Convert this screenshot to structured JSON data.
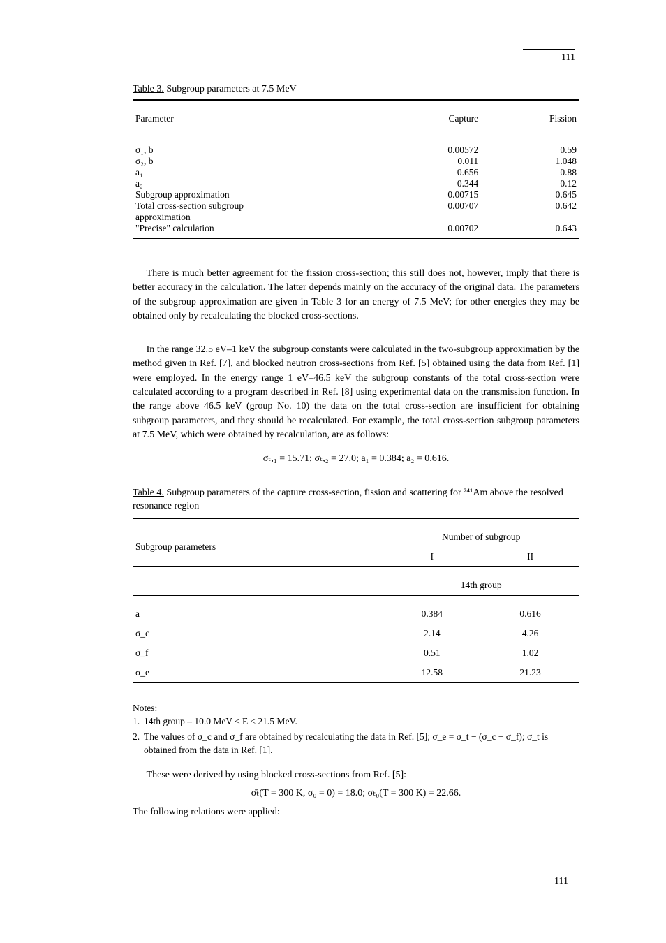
{
  "header": {
    "page_number": "111"
  },
  "table1": {
    "title_prefix": "Table 3.",
    "title_rest": " Subgroup parameters at 7.5 MeV",
    "headers": {
      "c1": "Parameter",
      "c2": "Capture",
      "c3": "Fission"
    },
    "row": {
      "c1": "σ₁, b\nσ₂, b\na₁\na₂\nSubgroup approximation\nTotal cross-section subgroup\napproximation\n\"Precise\" calculation",
      "c2": "0.00572\n0.011\n0.656\n0.344\n0.00715\n0.00707\n\n0.00702",
      "c3": "0.59\n1.048\n0.88\n0.12\n0.645\n0.642\n\n0.643"
    }
  },
  "para1": "There is much better agreement for the fission cross-section; this still does not, however, imply that there is better accuracy in the calculation. The latter depends mainly on the accuracy of the original data. The parameters of the subgroup approximation are given in Table 3 for an energy of 7.5 MeV; for other energies they may be obtained only by recalculating the blocked cross-sections.",
  "para2": "In the range 32.5 eV–1 keV the subgroup constants were calculated in the two-subgroup approximation by the method given in Ref. [7], and blocked neutron cross-sections from Ref. [5] obtained using the data from Ref. [1] were employed. In the energy range 1 eV–46.5 keV the subgroup constants of the total cross-section were calculated according to a program described in Ref. [8] using experimental data on the transmission function. In the range above 46.5 keV (group No. 10) the data on the total cross-section are insufficient for obtaining subgroup parameters, and they should be recalculated. For example, the total cross-section subgroup parameters at 7.5 MeV, which were obtained by recalculation, are as follows:",
  "params_line": "σₜ,₁ = 15.71;   σₜ,₂ = 27.0;   a₁ = 0.384;   a₂ = 0.616.",
  "table2": {
    "title_prefix": "Table 4.",
    "title_rest": " Subgroup parameters of the capture cross-section, fission and scattering for ²⁴¹Am above the resolved resonance region",
    "row1": {
      "c1_label": "Subgroup parameters",
      "c2": "Number of subgroup",
      "c3": ""
    },
    "row2": {
      "c1": "",
      "c2": "I",
      "c3": "II"
    },
    "row3": {
      "c1": "",
      "c2_head": "14th group",
      "c3_head": ""
    },
    "body": [
      {
        "c1": "a",
        "c2": "0.384",
        "c3": "0.616"
      },
      {
        "c1": "σ_c",
        "c2": "2.14",
        "c3": "4.26"
      },
      {
        "c1": "σ_f",
        "c2": "0.51",
        "c3": "1.02"
      },
      {
        "c1": "σ_e",
        "c2": "12.58",
        "c3": "21.23"
      }
    ]
  },
  "notes": {
    "intro": "Notes:",
    "items": [
      {
        "label": "1.",
        "text": "14th group – 10.0 MeV ≤ E ≤ 21.5 MeV."
      },
      {
        "label": "2.",
        "text": "The values of σ_c and σ_f are obtained by recalculating the data in Ref. [5]; σ_e = σ_t − (σ_c + σ_f); σ_t is obtained from the data in Ref. [1]."
      }
    ]
  },
  "after_notes": [
    "These were derived by using blocked cross-sections from Ref. [5]:",
    "σ̄ₜ(T = 300 K, σ₀ = 0) = 18.0;   σₜ₀(T = 300 K) = 22.66.",
    "The following relations were applied:"
  ],
  "footer": {
    "page_number": "111"
  },
  "chart_data": [
    {
      "type": "table",
      "title": "Table 3. Subgroup parameters at 7.5 MeV",
      "columns": [
        "Parameter",
        "Capture",
        "Fission"
      ],
      "rows": [
        [
          "σ₁, b",
          0.00572,
          0.59
        ],
        [
          "σ₂, b",
          0.011,
          1.048
        ],
        [
          "a₁",
          0.656,
          0.88
        ],
        [
          "a₂",
          0.344,
          0.12
        ],
        [
          "Subgroup approximation",
          0.00715,
          0.645
        ],
        [
          "Total cross-section subgroup approximation",
          0.00707,
          0.642
        ],
        [
          "\"Precise\" calculation",
          0.00702,
          0.643
        ]
      ]
    },
    {
      "type": "table",
      "title": "Table 4. Subgroup parameters of the capture cross-section, fission and scattering for 241Am above the resolved resonance region — 14th group",
      "columns": [
        "Subgroup parameter",
        "Subgroup I",
        "Subgroup II"
      ],
      "rows": [
        [
          "a",
          0.384,
          0.616
        ],
        [
          "σ_c",
          2.14,
          4.26
        ],
        [
          "σ_f",
          0.51,
          1.02
        ],
        [
          "σ_e",
          12.58,
          21.23
        ]
      ],
      "notes": "14th group – 10.0 MeV ≤ E ≤ 21.5 MeV. σ_e = σ_t − (σ_c + σ_f)."
    }
  ]
}
